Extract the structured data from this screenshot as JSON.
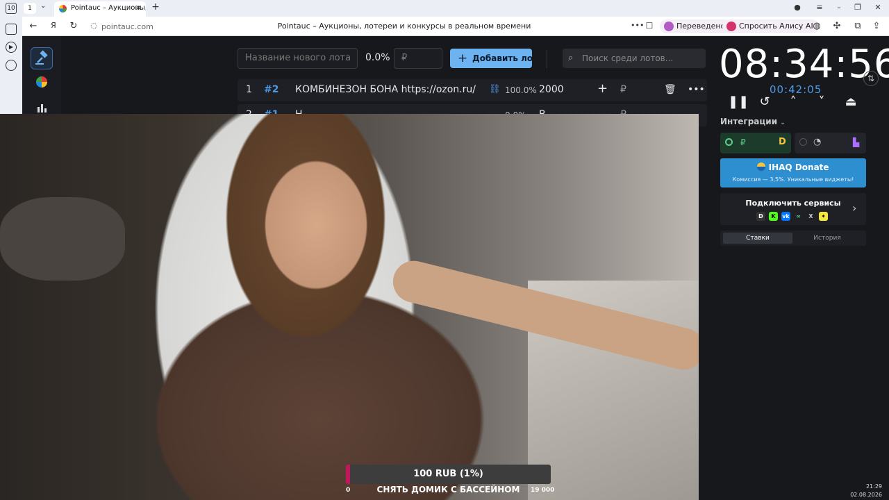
{
  "browser": {
    "tab_count": "1",
    "sidebar_badge": "10",
    "tab_title": "Pointauc – Аукционы, лотереи",
    "url": "pointauc.com",
    "page_title": "Pointauc – Аукционы, лотереи и конкурсы в реальном времени",
    "translated_label": "Переведено",
    "alice_label": "Спросить Алису AI"
  },
  "lot_form": {
    "name_placeholder": "Название нового лота",
    "percent": "0.0%",
    "amount_placeholder": "₽",
    "add_label": "Добавить лот",
    "search_placeholder": "Поиск среди лотов..."
  },
  "lots": [
    {
      "index": "1",
      "id": "#2",
      "name": "КОМБИНЕЗОН БОНА https://ozon.ru/t/cF",
      "percent": "100.0%",
      "amount": "2000",
      "currency": "₽"
    },
    {
      "index": "2",
      "id": "#1",
      "name": "Н",
      "percent": "0.0%",
      "amount": "В",
      "currency": "₽"
    }
  ],
  "timer": {
    "main": "08:34:56",
    "sub": "00:42:05"
  },
  "integrations": {
    "title": "Интеграции",
    "donate_title": "IHAQ Donate",
    "donate_sub": "Комиссия — 3,5%. Уникальные виджеты!",
    "connect_title": "Подключить сервисы",
    "tab_bets": "Ставки",
    "tab_history": "История"
  },
  "donation_goal": {
    "progress_text": "100 RUB (1%)",
    "progress_fraction": 0.01,
    "min": "0",
    "max": "19 000",
    "title": "СНЯТЬ ДОМИК С БАССЕЙНОМ"
  },
  "system": {
    "time": "21:29",
    "date": "02.08.2026"
  },
  "colors": {
    "accent": "#6db3f2",
    "timer_sub": "#4d9ae6",
    "donate_bg": "#2d8fd0",
    "goal_fill": "#c2185b"
  }
}
